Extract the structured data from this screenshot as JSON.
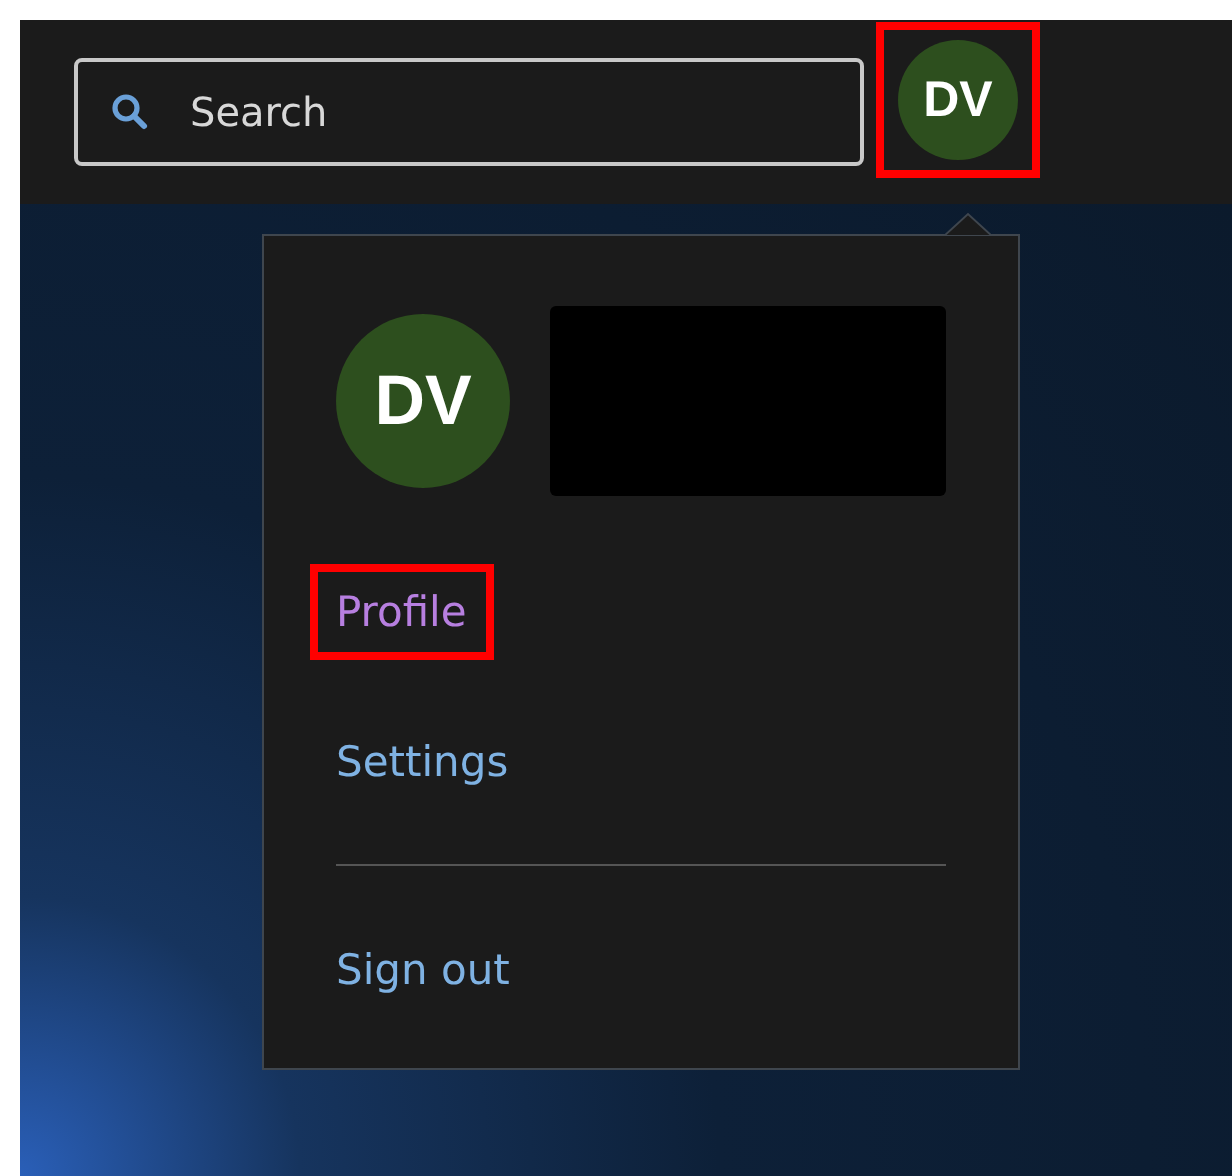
{
  "header": {
    "search": {
      "placeholder": "Search"
    },
    "avatar": {
      "initials": "DV",
      "highlighted": true
    }
  },
  "account_menu": {
    "avatar": {
      "initials": "DV"
    },
    "name_redacted": true,
    "items": [
      {
        "label": "Profile",
        "visited": true,
        "highlighted": true
      },
      {
        "label": "Settings",
        "visited": false,
        "highlighted": false
      },
      {
        "label": "Sign out",
        "visited": false,
        "highlighted": false,
        "divider_before": true
      }
    ]
  }
}
